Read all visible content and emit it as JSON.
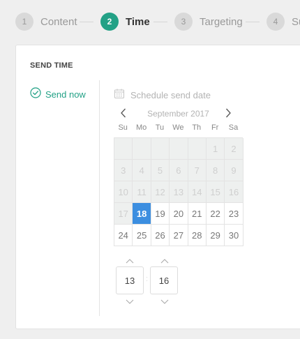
{
  "stepper": {
    "steps": [
      {
        "number": "1",
        "label": "Content"
      },
      {
        "number": "2",
        "label": "Time"
      },
      {
        "number": "3",
        "label": "Targeting"
      },
      {
        "number": "4",
        "label": "Su"
      }
    ],
    "active_index": 1
  },
  "send_time": {
    "section_title": "SEND TIME",
    "send_now_label": "Send now",
    "schedule_label": "Schedule send date"
  },
  "calendar": {
    "month_title": "September 2017",
    "weekdays": [
      "Su",
      "Mo",
      "Tu",
      "We",
      "Th",
      "Fr",
      "Sa"
    ],
    "days": [
      "",
      "",
      "",
      "",
      "",
      "1",
      "2",
      "3",
      "4",
      "5",
      "6",
      "7",
      "8",
      "9",
      "10",
      "11",
      "12",
      "13",
      "14",
      "15",
      "16",
      "17",
      "18",
      "19",
      "20",
      "21",
      "22",
      "23",
      "24",
      "25",
      "26",
      "27",
      "28",
      "29",
      "30"
    ],
    "selected_day": "18",
    "disabled_before_day": 18
  },
  "time": {
    "hour": "13",
    "separator": ":",
    "minute": "16"
  },
  "colors": {
    "accent_green": "#23a186",
    "selected_blue": "#3c8ee0"
  }
}
